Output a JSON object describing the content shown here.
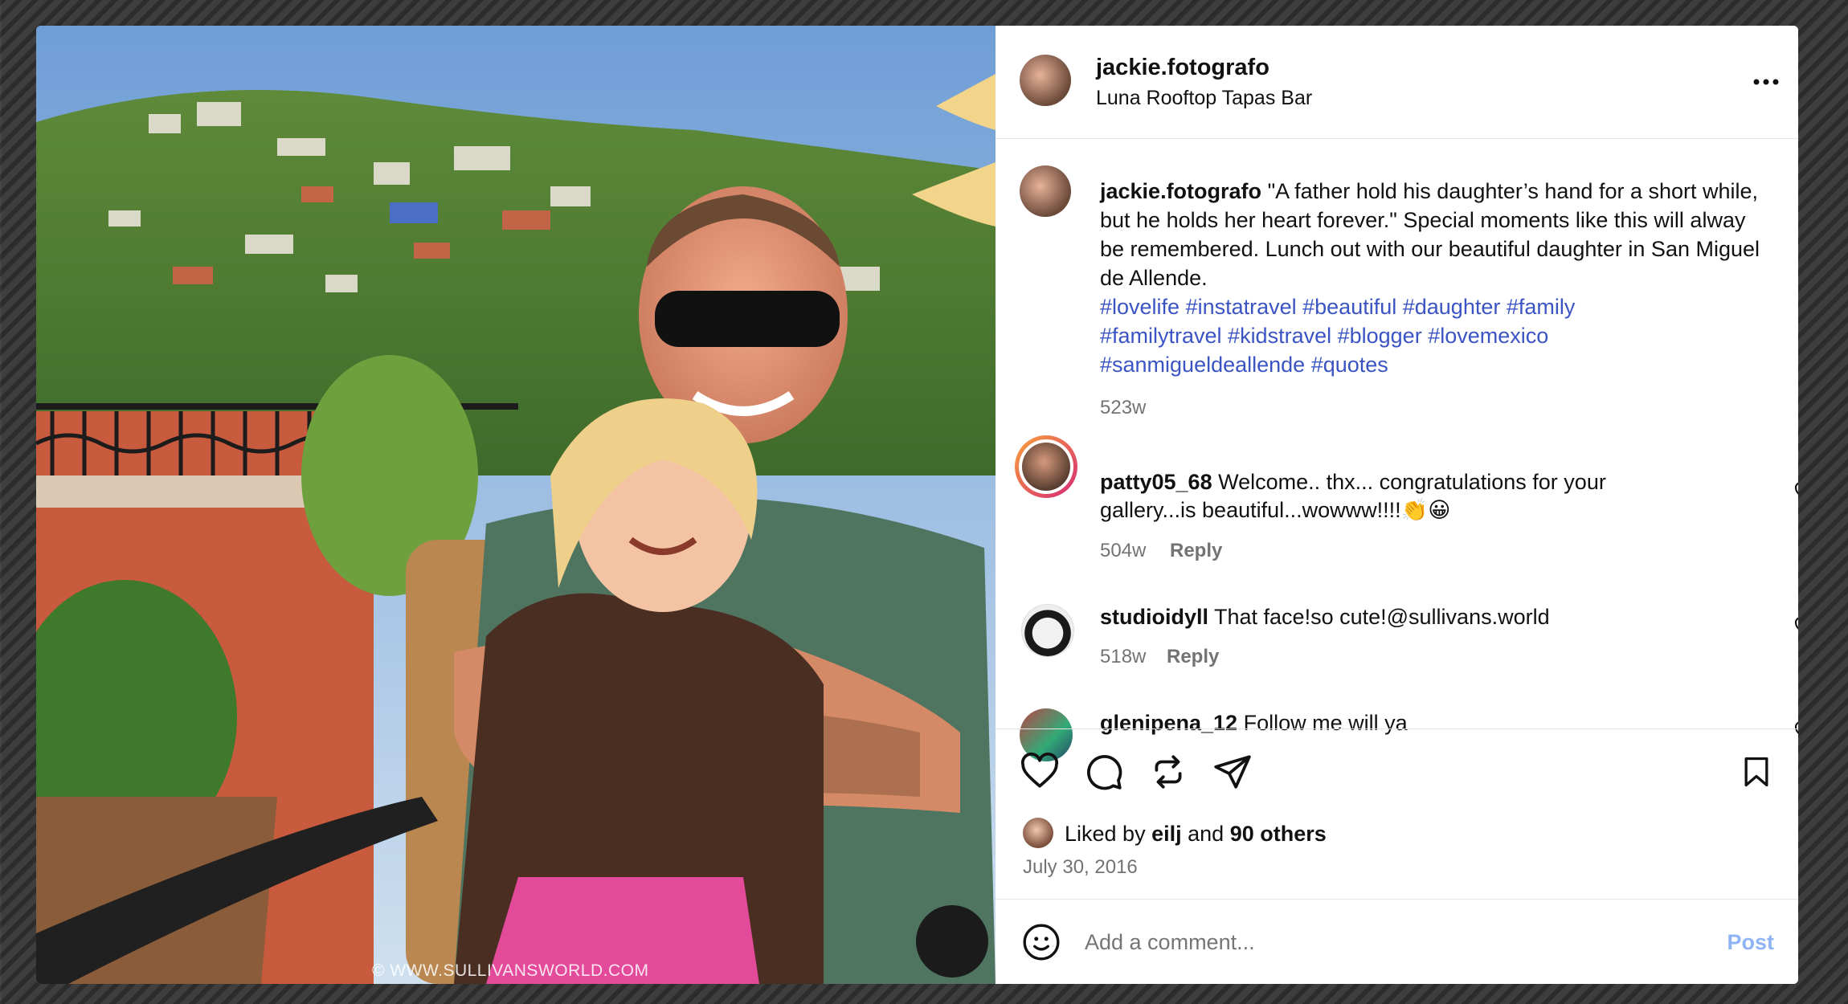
{
  "post": {
    "username": "jackie.fotografo",
    "location": "Luna Rooftop Tapas Bar",
    "more_icon": "more-horizontal-icon",
    "caption_user": "jackie.fotografo",
    "caption_text": "\"A father hold his daughter’s hand for a short while, but he holds her heart forever.\" Special moments like this will alway be remembered. Lunch out with our beautiful daughter in San Miguel de Allende.",
    "hashtags_line1": "#lovelife #instatravel #beautiful #daughter #family",
    "hashtags_line2": "#familytravel #kidstravel #blogger #lovemexico",
    "hashtags_line3": "#sanmigueldeallende #quotes",
    "caption_age": "523w",
    "watermark": "© WWW.SULLIVANSWORLD.COM"
  },
  "comments": [
    {
      "user": "patty05_68",
      "text_line1": "Welcome.. thx... congratulations for your",
      "text_line2": "gallery...is beautiful...wowww!!!!👏😀",
      "age": "504w",
      "reply": "Reply"
    },
    {
      "user": "studioidyll",
      "text": "That face!so cute!@sullivans.world",
      "age": "518w",
      "reply": "Reply"
    },
    {
      "user": "glenipena_12",
      "text": "Follow me will ya"
    }
  ],
  "actions": {
    "liked_by_prefix": "Liked by",
    "liked_by_user": "eilj",
    "liked_by_and": "and",
    "liked_by_others": "90 others",
    "date": "July 30, 2016"
  },
  "add_comment": {
    "placeholder": "Add a comment...",
    "post_label": "Post"
  },
  "colors": {
    "link": "#3b54c4",
    "post_button": "#8fb4f5",
    "story_ring_start": "#f9a13a",
    "story_ring_end": "#d62976"
  }
}
